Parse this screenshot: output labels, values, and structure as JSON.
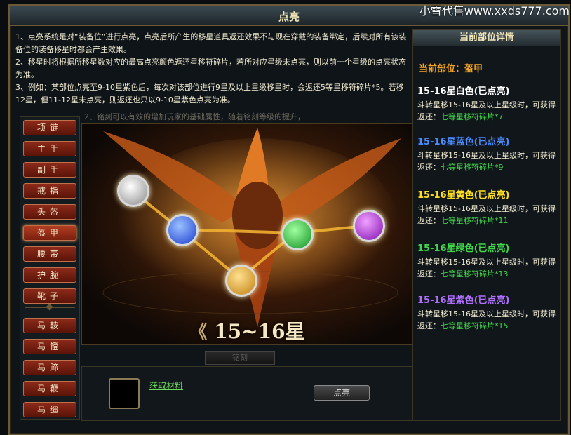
{
  "window": {
    "title": "点亮",
    "watermark": "小雪代售www.xxds777.com"
  },
  "description": {
    "line1": "1、点亮系统是对“装备位”进行点亮，点亮后所产生的移星道具返还效果不与现在穿戴的装备绑定，后续对所有该装备位的装备移星时都会产生效果。",
    "line2": "2、移星时将根据所移星数对应的最高点亮颜色返还星移符碎片，若所对应星级未点亮，则以前一个星级的点亮状态为准。",
    "line3": "3、例如：某部位点亮至9-10星紫色后，每次对该部位进行9星及以上星级移星时，会返还5等星移符碎片*5。若移12星，但11-12星未点亮，则返还也只以9-10星紫色点亮为准。"
  },
  "art": {
    "hint": "2、铭刻可以有效的增加玩家的基础属性，随着铭刻等级的提升，",
    "star_label": "15~16星",
    "arrow_left": "《",
    "arrow_right": "》"
  },
  "slots": [
    "项链",
    "主手",
    "副手",
    "戒指",
    "头盔",
    "盔甲",
    "腰带",
    "护腕",
    "靴子",
    "马鞍",
    "马镫",
    "马蹄",
    "马鞭",
    "马缰"
  ],
  "active_slot": "盔甲",
  "gems": [
    {
      "name": "white",
      "color": "#eeeeee"
    },
    {
      "name": "blue",
      "color": "#2a5cff"
    },
    {
      "name": "gold",
      "color": "#f0b020"
    },
    {
      "name": "green",
      "color": "#22c030"
    },
    {
      "name": "purple",
      "color": "#b020e0"
    }
  ],
  "bottom": {
    "material_link": "获取材料",
    "light_button": "点亮",
    "ghost_button": "铭刻"
  },
  "detail": {
    "heading": "当前部位详情",
    "current_slot": "当前部位：盔甲",
    "tiers": [
      {
        "title": "15-16星白色(已点亮)",
        "color": "#ffffff",
        "desc": "斗转星移15-16星及以上星级时，可获得返还：",
        "reward": "七等星移符碎片*7"
      },
      {
        "title": "15-16星蓝色(已点亮)",
        "color": "#4a8cff",
        "desc": "斗转星移15-16星及以上星级时，可获得返还：",
        "reward": "七等星移符碎片*9"
      },
      {
        "title": "15-16星黄色(已点亮)",
        "color": "#ffe020",
        "desc": "斗转星移15-16星及以上星级时，可获得返还：",
        "reward": "七等星移符碎片*11"
      },
      {
        "title": "15-16星绿色(已点亮)",
        "color": "#3fd64a",
        "desc": "斗转星移15-16星及以上星级时，可获得返还：",
        "reward": "七等星移符碎片*13"
      },
      {
        "title": "15-16星紫色(已点亮)",
        "color": "#b070ff",
        "desc": "斗转星移15-16星及以上星级时，可获得返还：",
        "reward": "七等星移符碎片*15"
      }
    ]
  }
}
